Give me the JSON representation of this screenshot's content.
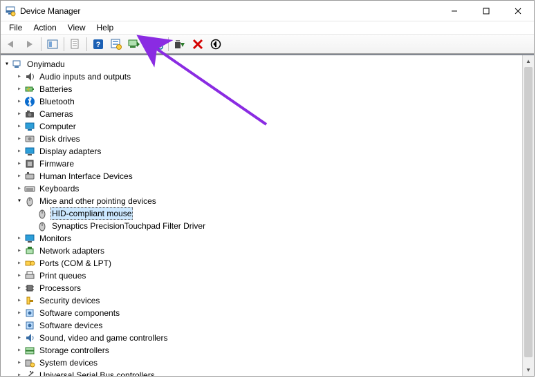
{
  "window": {
    "title": "Device Manager"
  },
  "menu": {
    "file": "File",
    "action": "Action",
    "view": "View",
    "help": "Help"
  },
  "toolbar": {
    "back": "Back",
    "fwd": "Forward",
    "show_connection": "Show/Hide Console Tree",
    "properties": "Properties",
    "help": "Help",
    "action_props": "Properties",
    "update_driver": "Update Driver",
    "scan_hw": "Scan for hardware changes",
    "uninstall": "Uninstall device",
    "disable": "Disable device",
    "legacy": "Add legacy hardware"
  },
  "tree": {
    "root": {
      "label": "Onyimadu",
      "expanded": true
    },
    "nodes": [
      {
        "id": "audio",
        "label": "Audio inputs and outputs",
        "expanded": false
      },
      {
        "id": "batteries",
        "label": "Batteries",
        "expanded": false
      },
      {
        "id": "bluetooth",
        "label": "Bluetooth",
        "expanded": false
      },
      {
        "id": "cameras",
        "label": "Cameras",
        "expanded": false
      },
      {
        "id": "computer",
        "label": "Computer",
        "expanded": false
      },
      {
        "id": "disk",
        "label": "Disk drives",
        "expanded": false
      },
      {
        "id": "display",
        "label": "Display adapters",
        "expanded": false
      },
      {
        "id": "firmware",
        "label": "Firmware",
        "expanded": false
      },
      {
        "id": "hid",
        "label": "Human Interface Devices",
        "expanded": false
      },
      {
        "id": "keyboards",
        "label": "Keyboards",
        "expanded": false
      },
      {
        "id": "mice",
        "label": "Mice and other pointing devices",
        "expanded": true,
        "children": [
          {
            "id": "hid-mouse",
            "label": "HID-compliant mouse",
            "selected": true
          },
          {
            "id": "synaptics",
            "label": "Synaptics PrecisionTouchpad Filter Driver"
          }
        ]
      },
      {
        "id": "monitors",
        "label": "Monitors",
        "expanded": false
      },
      {
        "id": "network",
        "label": "Network adapters",
        "expanded": false
      },
      {
        "id": "ports",
        "label": "Ports (COM & LPT)",
        "expanded": false
      },
      {
        "id": "printq",
        "label": "Print queues",
        "expanded": false
      },
      {
        "id": "processors",
        "label": "Processors",
        "expanded": false
      },
      {
        "id": "security",
        "label": "Security devices",
        "expanded": false
      },
      {
        "id": "swcomp",
        "label": "Software components",
        "expanded": false
      },
      {
        "id": "swdev",
        "label": "Software devices",
        "expanded": false
      },
      {
        "id": "sound",
        "label": "Sound, video and game controllers",
        "expanded": false
      },
      {
        "id": "storage",
        "label": "Storage controllers",
        "expanded": false
      },
      {
        "id": "system",
        "label": "System devices",
        "expanded": false
      },
      {
        "id": "usb",
        "label": "Universal Serial Bus controllers",
        "expanded": false
      }
    ]
  },
  "annotation": {
    "color": "#8A2BE2"
  }
}
